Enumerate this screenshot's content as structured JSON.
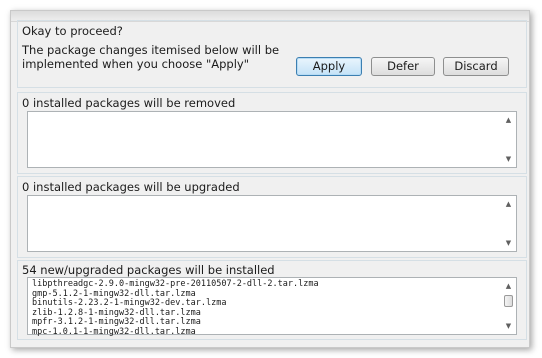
{
  "confirm": {
    "heading": "Okay to proceed?",
    "description": "The package changes itemised below will be implemented when you choose \"Apply\"",
    "apply_label": "Apply",
    "defer_label": "Defer",
    "discard_label": "Discard"
  },
  "removed": {
    "label": "0 installed packages will be removed"
  },
  "upgraded": {
    "label": "0 installed packages will be upgraded"
  },
  "installed": {
    "label": "54 new/upgraded packages will be installed",
    "packages": [
      "libpthreadgc-2.9.0-mingw32-pre-20110507-2-dll-2.tar.lzma",
      "gmp-5.1.2-1-mingw32-dll.tar.lzma",
      "binutils-2.23.2-1-mingw32-dev.tar.lzma",
      "zlib-1.2.8-1-mingw32-dll.tar.lzma",
      "mpfr-3.1.2-1-mingw32-dll.tar.lzma",
      "mpc-1.0.1-1-mingw32-dll.tar.lzma"
    ]
  },
  "icons": {
    "scroll_up": "scroll-up-arrow-icon",
    "scroll_down": "scroll-down-arrow-icon"
  },
  "colors": {
    "dialog_bg": "#f0f0f0",
    "primary_button_border": "#3c7fb1",
    "group_border": "#d5dfe5"
  }
}
